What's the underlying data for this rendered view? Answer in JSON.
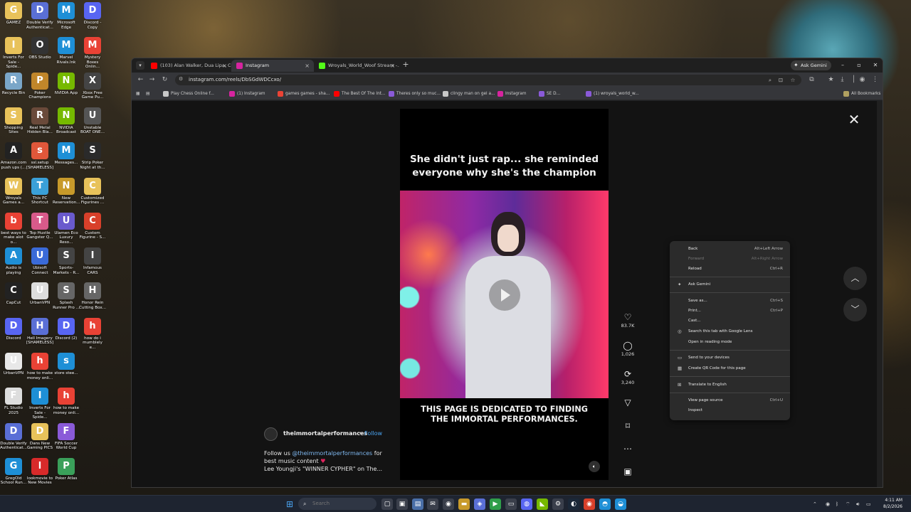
{
  "desktop": {
    "icons": [
      {
        "label": "GAMEZ",
        "icon": "folder-icon",
        "color": "#e8c25a"
      },
      {
        "label": "Double Verify Authenticat...",
        "icon": "shield-icon",
        "color": "#5a6fd6"
      },
      {
        "label": "Microsoft Edge",
        "icon": "edge-icon",
        "color": "#1e8fd6"
      },
      {
        "label": "Discord - Copy",
        "icon": "discord-icon",
        "color": "#5865f2"
      },
      {
        "label": "Inverts For Sale - Spide...",
        "icon": "folder-icon",
        "color": "#e8c25a"
      },
      {
        "label": "OBS Studio",
        "icon": "obs-icon",
        "color": "#333333"
      },
      {
        "label": "Marvel Rivals.lnk",
        "icon": "edge-icon",
        "color": "#1e8fd6"
      },
      {
        "label": "Mystery Boxes Onlin...",
        "icon": "google-icon",
        "color": "#e94235"
      },
      {
        "label": "Recycle Bin",
        "icon": "recycle-bin-icon",
        "color": "#7aa6c8"
      },
      {
        "label": "Poker Champions",
        "icon": "poker-icon",
        "color": "#c0862a"
      },
      {
        "label": "NVIDIA App",
        "icon": "nvidia-icon",
        "color": "#76b900"
      },
      {
        "label": "Xbox Free Game Pu...",
        "icon": "car-icon",
        "color": "#444444"
      },
      {
        "label": "Shopping Sites",
        "icon": "folder-icon",
        "color": "#e8c25a"
      },
      {
        "label": "Real Metal Hidden Bla...",
        "icon": "game-icon",
        "color": "#6a4a3a"
      },
      {
        "label": "NVIDIA Broadcast",
        "icon": "nvidia-broadcast-icon",
        "color": "#76b900"
      },
      {
        "label": "Unstable BOAT ONE...",
        "icon": "d-icon",
        "color": "#555555"
      },
      {
        "label": "Amazon.com push ups (...",
        "icon": "amazon-icon",
        "color": "#222222"
      },
      {
        "label": "ssl.setup [SHAMELESS]",
        "icon": "setup-icon",
        "color": "#e0573a"
      },
      {
        "label": "Messages...",
        "icon": "edge-icon",
        "color": "#1e8fd6"
      },
      {
        "label": "Strip Poker Night at th...",
        "icon": "cards-icon",
        "color": "#2a2a2a"
      },
      {
        "label": "Wroyals Games a...",
        "icon": "folder-icon",
        "color": "#e8c25a"
      },
      {
        "label": "This PC Shortcut",
        "icon": "pc-icon",
        "color": "#3aa0d8"
      },
      {
        "label": "New Reservation...",
        "icon": "reservation-icon",
        "color": "#c89a2a"
      },
      {
        "label": "Customized Figurines ...",
        "icon": "note-icon",
        "color": "#e8c25a"
      },
      {
        "label": "best ways to make alot o...",
        "icon": "google-icon",
        "color": "#e94235"
      },
      {
        "label": "Top Hustle Gangster Q...",
        "icon": "hustle-icon",
        "color": "#d85a8a"
      },
      {
        "label": "Ulamen Eco Luxury Reso...",
        "icon": "resort-icon",
        "color": "#6a5acd"
      },
      {
        "label": "Custom Figurine - S...",
        "icon": "custom-icon",
        "color": "#d8402a"
      },
      {
        "label": "Audio is playing",
        "icon": "edge-icon",
        "color": "#1e8fd6"
      },
      {
        "label": "Ubisoft Connect",
        "icon": "ubisoft-icon",
        "color": "#3a6ad8"
      },
      {
        "label": "Sports-Markets - R...",
        "icon": "sports-icon",
        "color": "#444444"
      },
      {
        "label": "Infamous CARS",
        "icon": "car-icon",
        "color": "#444444"
      },
      {
        "label": "CapCut",
        "icon": "capcut-icon",
        "color": "#222222"
      },
      {
        "label": "UrbanVPN",
        "icon": "file-icon",
        "color": "#dddddd"
      },
      {
        "label": "Splash Runner Pro ...",
        "icon": "s-icon",
        "color": "#666666"
      },
      {
        "label": "Honor Rein Cutting Box...",
        "icon": "h-icon",
        "color": "#666666"
      },
      {
        "label": "Discord",
        "icon": "discord-icon",
        "color": "#5865f2"
      },
      {
        "label": "Hell Imagery [SHAMELESS]",
        "icon": "shield-icon",
        "color": "#5a6fd6"
      },
      {
        "label": "Discord (2)",
        "icon": "discord-icon",
        "color": "#5865f2"
      },
      {
        "label": "how do i mumblely e...",
        "icon": "google-icon",
        "color": "#e94235"
      },
      {
        "label": "UrbanVPN",
        "icon": "urbanvpn-icon",
        "color": "#e8e8e8"
      },
      {
        "label": "how to make money onli...",
        "icon": "google-icon",
        "color": "#e94235"
      },
      {
        "label": "store stee...",
        "icon": "edge-icon",
        "color": "#1e8fd6"
      },
      {
        "label": "",
        "icon": "blank-icon",
        "color": "#00000000"
      },
      {
        "label": "FL Studio 2025",
        "icon": "file-icon",
        "color": "#dddddd"
      },
      {
        "label": "Inverts For Sale - Spide...",
        "icon": "edge-icon",
        "color": "#1e8fd6"
      },
      {
        "label": "how to make money onli...",
        "icon": "google-icon",
        "color": "#e94235"
      },
      {
        "label": "",
        "icon": "blank-icon",
        "color": "#00000000"
      },
      {
        "label": "Double Verify Authenticat...",
        "icon": "shield-icon",
        "color": "#5a6fd6"
      },
      {
        "label": "Dans New Gaming PICS",
        "icon": "folder-icon",
        "color": "#e8c25a"
      },
      {
        "label": "FIFA Soccer World Cup",
        "icon": "fifa-icon",
        "color": "#8a5ad8"
      },
      {
        "label": "",
        "icon": "blank-icon",
        "color": "#00000000"
      },
      {
        "label": "GregOld School Run...",
        "icon": "edge-icon",
        "color": "#1e8fd6"
      },
      {
        "label": "lookmovie to New Movies",
        "icon": "lookmovie-icon",
        "color": "#d82a2a"
      },
      {
        "label": "Poker Atlas",
        "icon": "poker-atlas-icon",
        "color": "#3aa05a"
      }
    ]
  },
  "browser": {
    "tabs": [
      {
        "title": "(103) Alan Walker, Dua Lipa, Co...",
        "favicon": "youtube-icon",
        "color": "#ff0000",
        "active": false
      },
      {
        "title": "Instagram",
        "favicon": "instagram-icon",
        "color": "#d6249f",
        "active": true
      },
      {
        "title": "Wroyals_World_Woof Stream -...",
        "favicon": "kick-icon",
        "color": "#53fc18",
        "active": false
      }
    ],
    "ask_gemini": "Ask Gemini",
    "url": "instagram.com/reels/DbSGdWDCcxo/",
    "bookmarks": [
      {
        "label": "Play Chess Online f...",
        "icon": "chess-icon",
        "color": "#c8c8c8"
      },
      {
        "label": "(1) Instagram",
        "icon": "instagram-icon",
        "color": "#d6249f"
      },
      {
        "label": "games games - sha...",
        "icon": "gmail-icon",
        "color": "#ea4335"
      },
      {
        "label": "The Best Of The Int...",
        "icon": "youtube-icon",
        "color": "#ff0000"
      },
      {
        "label": "Theres only so muc...",
        "icon": "bookmark-icon",
        "color": "#8a5ad8"
      },
      {
        "label": "clingy man on gel a...",
        "icon": "globe-icon",
        "color": "#c8c8c8"
      },
      {
        "label": "Instagram",
        "icon": "instagram-icon",
        "color": "#d6249f"
      },
      {
        "label": "SE D...",
        "icon": "bookmark-icon",
        "color": "#8a5ad8"
      },
      {
        "label": "(1) wroyals_world_w...",
        "icon": "bookmark-icon",
        "color": "#8a5ad8"
      }
    ],
    "all_bookmarks": "All Bookmarks"
  },
  "reel": {
    "caption_top_line1": "She didn't just rap... she reminded",
    "caption_top_line2": "everyone why she's the champion",
    "caption_bottom_line1": "THIS PAGE IS DEDICATED TO FINDING",
    "caption_bottom_line2": "THE IMMORTAL PERFORMANCES.",
    "author": "theimmortalperformances",
    "separator": "•",
    "follow": "Follow",
    "desc_prefix": "Follow us ",
    "desc_mention": "@theimmortalperformances",
    "desc_suffix": " for best music content ",
    "desc_heart": "♥",
    "desc_line2": "Lee Youngji's \"WINNER CYPHER\" on The...",
    "likes": "83.7K",
    "comments": "1,026",
    "reposts": "3,240"
  },
  "context_menu": {
    "back": "Back",
    "back_sc": "Alt+Left Arrow",
    "forward": "Forward",
    "forward_sc": "Alt+Right Arrow",
    "reload": "Reload",
    "reload_sc": "Ctrl+R",
    "ask_gemini": "Ask Gemini",
    "save_as": "Save as...",
    "save_as_sc": "Ctrl+S",
    "print": "Print...",
    "print_sc": "Ctrl+P",
    "cast": "Cast...",
    "lens": "Search this tab with Google Lens",
    "reading_mode": "Open in reading mode",
    "send_devices": "Send to your devices",
    "qr_code": "Create QR Code for this page",
    "translate": "Translate to English",
    "view_source": "View page source",
    "view_source_sc": "Ctrl+U",
    "inspect": "Inspect"
  },
  "taskbar": {
    "search_placeholder": "Search",
    "time": "4:11 AM",
    "date": "8/2/2026"
  }
}
